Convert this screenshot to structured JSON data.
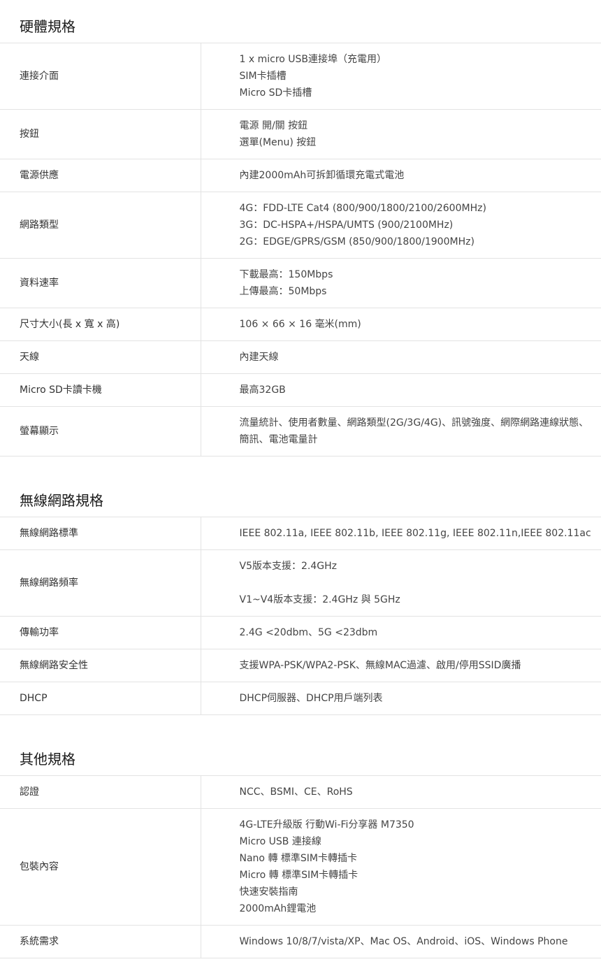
{
  "sections": [
    {
      "title": "硬體規格",
      "rows": [
        {
          "label": "連接介面",
          "lines": [
            "1 x micro USB連接埠（充電用）",
            "SIM卡插槽",
            "Micro SD卡插槽"
          ]
        },
        {
          "label": "按鈕",
          "lines": [
            "電源 開/關 按鈕",
            "選單(Menu) 按鈕"
          ]
        },
        {
          "label": "電源供應",
          "lines": [
            "內建2000mAh可拆卸循環充電式電池"
          ]
        },
        {
          "label": "網路類型",
          "lines": [
            "4G：FDD-LTE Cat4 (800/900/1800/2100/2600MHz)",
            "3G：DC-HSPA+/HSPA/UMTS (900/2100MHz)",
            "2G：EDGE/GPRS/GSM (850/900/1800/1900MHz)"
          ]
        },
        {
          "label": "資料速率",
          "lines": [
            "下載最高：150Mbps",
            "上傳最高：50Mbps"
          ]
        },
        {
          "label": "尺寸大小(長 x 寬 x 高)",
          "lines": [
            "106 × 66 × 16 毫米(mm)"
          ]
        },
        {
          "label": "天線",
          "lines": [
            "內建天線"
          ]
        },
        {
          "label": "Micro SD卡讀卡機",
          "lines": [
            "最高32GB"
          ]
        },
        {
          "label": "螢幕顯示",
          "lines": [
            "流量統計、使用者數量、網路類型(2G/3G/4G)、訊號強度、網際網路連線狀態、簡訊、電池電量計"
          ]
        }
      ]
    },
    {
      "title": "無線網路規格",
      "rows": [
        {
          "label": "無線網路標準",
          "lines": [
            "IEEE 802.11a, IEEE 802.11b, IEEE 802.11g, IEEE 802.11n,IEEE 802.11ac"
          ]
        },
        {
          "label": "無線網路頻率",
          "lines": [
            "V5版本支援：2.4GHz",
            "V1~V4版本支援：2.4GHz 與 5GHz"
          ]
        },
        {
          "label": "傳輸功率",
          "lines": [
            "2.4G <20dbm、5G <23dbm"
          ]
        },
        {
          "label": "無線網路安全性",
          "lines": [
            "支援WPA-PSK/WPA2-PSK、無線MAC過濾、啟用/停用SSID廣播"
          ]
        },
        {
          "label": "DHCP",
          "lines": [
            "DHCP伺服器、DHCP用戶端列表"
          ]
        }
      ]
    },
    {
      "title": "其他規格",
      "rows": [
        {
          "label": "認證",
          "lines": [
            "NCC、BSMI、CE、RoHS"
          ]
        },
        {
          "label": "包裝內容",
          "lines": [
            "4G-LTE升級版 行動Wi-Fi分享器 M7350",
            "Micro USB 連接線",
            "Nano 轉 標準SIM卡轉插卡",
            "Micro 轉 標準SIM卡轉插卡",
            "快速安裝指南",
            "2000mAh鋰電池"
          ]
        },
        {
          "label": "系統需求",
          "lines": [
            "Windows 10/8/7/vista/XP、Mac OS、Android、iOS、Windows Phone"
          ]
        }
      ]
    }
  ]
}
